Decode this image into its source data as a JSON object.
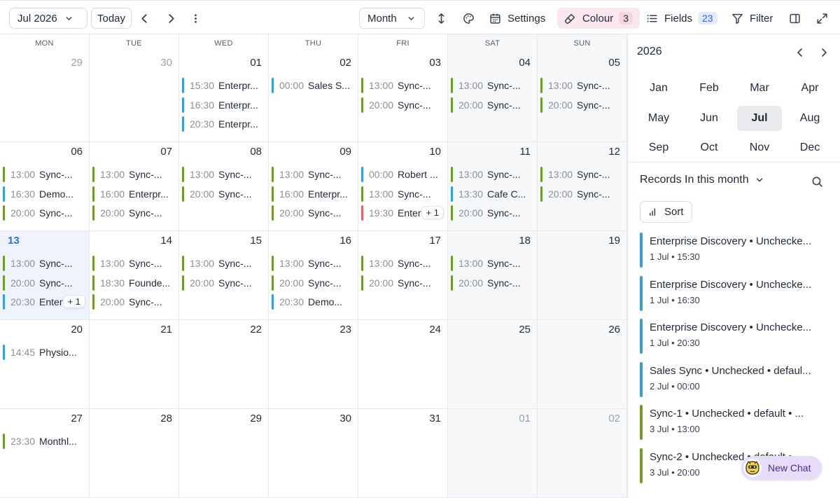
{
  "toolbar": {
    "date_label": "Jul 2026",
    "today_label": "Today",
    "view_label": "Month",
    "settings_label": "Settings",
    "colour_label": "Colour",
    "colour_count": "3",
    "fields_label": "Fields",
    "fields_count": "23",
    "filter_label": "Filter"
  },
  "colors": {
    "green": "#6f9b2c",
    "blue": "#3a9ed6",
    "red": "#e06565",
    "today_bg": "#eef3fe",
    "accent": "#2f6fe4"
  },
  "calendar": {
    "weekdays": [
      "MON",
      "TUE",
      "WED",
      "THU",
      "FRI",
      "SAT",
      "SUN"
    ],
    "days": [
      {
        "n": "29",
        "other": true,
        "events": []
      },
      {
        "n": "30",
        "other": true,
        "events": []
      },
      {
        "n": "01",
        "events": [
          {
            "t": "15:30",
            "l": "Enterpr...",
            "c": "blue"
          },
          {
            "t": "16:30",
            "l": "Enterpr...",
            "c": "blue"
          },
          {
            "t": "20:30",
            "l": "Enterpr...",
            "c": "blue"
          }
        ]
      },
      {
        "n": "02",
        "events": [
          {
            "t": "00:00",
            "l": "Sales S...",
            "c": "blue"
          }
        ]
      },
      {
        "n": "03",
        "events": [
          {
            "t": "13:00",
            "l": "Sync-...",
            "c": "green"
          },
          {
            "t": "20:00",
            "l": "Sync-...",
            "c": "green"
          }
        ]
      },
      {
        "n": "04",
        "weekend": true,
        "events": [
          {
            "t": "13:00",
            "l": "Sync-...",
            "c": "green"
          },
          {
            "t": "20:00",
            "l": "Sync-...",
            "c": "green"
          }
        ]
      },
      {
        "n": "05",
        "weekend": true,
        "events": [
          {
            "t": "13:00",
            "l": "Sync-...",
            "c": "green"
          },
          {
            "t": "20:00",
            "l": "Sync-...",
            "c": "green"
          }
        ]
      },
      {
        "n": "06",
        "events": [
          {
            "t": "13:00",
            "l": "Sync-...",
            "c": "green"
          },
          {
            "t": "16:30",
            "l": "Demo...",
            "c": "blue"
          },
          {
            "t": "20:00",
            "l": "Sync-...",
            "c": "green"
          }
        ]
      },
      {
        "n": "07",
        "events": [
          {
            "t": "13:00",
            "l": "Sync-...",
            "c": "green"
          },
          {
            "t": "16:00",
            "l": "Enterpr...",
            "c": "green"
          },
          {
            "t": "20:00",
            "l": "Sync-...",
            "c": "green"
          }
        ]
      },
      {
        "n": "08",
        "events": [
          {
            "t": "13:00",
            "l": "Sync-...",
            "c": "green"
          },
          {
            "t": "20:00",
            "l": "Sync-...",
            "c": "green"
          }
        ]
      },
      {
        "n": "09",
        "events": [
          {
            "t": "13:00",
            "l": "Sync-...",
            "c": "green"
          },
          {
            "t": "16:00",
            "l": "Enterpr...",
            "c": "green"
          },
          {
            "t": "20:00",
            "l": "Sync-...",
            "c": "green"
          }
        ]
      },
      {
        "n": "10",
        "more": "+ 1",
        "events": [
          {
            "t": "00:00",
            "l": "Robert ...",
            "c": "blue"
          },
          {
            "t": "13:00",
            "l": "Sync-...",
            "c": "green"
          },
          {
            "t": "19:30",
            "l": "Enter",
            "c": "red"
          }
        ]
      },
      {
        "n": "11",
        "weekend": true,
        "events": [
          {
            "t": "13:00",
            "l": "Sync-...",
            "c": "green"
          },
          {
            "t": "13:30",
            "l": "Cafe C...",
            "c": "blue"
          },
          {
            "t": "20:00",
            "l": "Sync-...",
            "c": "green"
          }
        ]
      },
      {
        "n": "12",
        "weekend": true,
        "events": [
          {
            "t": "13:00",
            "l": "Sync-...",
            "c": "green"
          },
          {
            "t": "20:00",
            "l": "Sync-...",
            "c": "green"
          }
        ]
      },
      {
        "n": "13",
        "today": true,
        "more": "+ 1",
        "events": [
          {
            "t": "13:00",
            "l": "Sync-...",
            "c": "green"
          },
          {
            "t": "20:00",
            "l": "Sync-...",
            "c": "green"
          },
          {
            "t": "20:30",
            "l": "Enter",
            "c": "blue"
          }
        ]
      },
      {
        "n": "14",
        "events": [
          {
            "t": "13:00",
            "l": "Sync-...",
            "c": "green"
          },
          {
            "t": "18:30",
            "l": "Founde...",
            "c": "green"
          },
          {
            "t": "20:00",
            "l": "Sync-...",
            "c": "green"
          }
        ]
      },
      {
        "n": "15",
        "events": [
          {
            "t": "13:00",
            "l": "Sync-...",
            "c": "green"
          },
          {
            "t": "20:00",
            "l": "Sync-...",
            "c": "green"
          }
        ]
      },
      {
        "n": "16",
        "events": [
          {
            "t": "13:00",
            "l": "Sync-...",
            "c": "green"
          },
          {
            "t": "20:00",
            "l": "Sync-...",
            "c": "green"
          },
          {
            "t": "20:30",
            "l": "Demo...",
            "c": "blue"
          }
        ]
      },
      {
        "n": "17",
        "events": [
          {
            "t": "13:00",
            "l": "Sync-...",
            "c": "green"
          },
          {
            "t": "20:00",
            "l": "Sync-...",
            "c": "green"
          }
        ]
      },
      {
        "n": "18",
        "weekend": true,
        "events": [
          {
            "t": "13:00",
            "l": "Sync-...",
            "c": "green"
          },
          {
            "t": "20:00",
            "l": "Sync-...",
            "c": "green"
          }
        ]
      },
      {
        "n": "19",
        "weekend": true,
        "events": []
      },
      {
        "n": "20",
        "events": [
          {
            "t": "14:45",
            "l": "Physio...",
            "c": "blue"
          }
        ]
      },
      {
        "n": "21",
        "events": []
      },
      {
        "n": "22",
        "events": []
      },
      {
        "n": "23",
        "events": []
      },
      {
        "n": "24",
        "events": []
      },
      {
        "n": "25",
        "weekend": true,
        "events": []
      },
      {
        "n": "26",
        "weekend": true,
        "events": []
      },
      {
        "n": "27",
        "events": [
          {
            "t": "23:30",
            "l": "Monthl...",
            "c": "green"
          }
        ]
      },
      {
        "n": "28",
        "events": []
      },
      {
        "n": "29",
        "events": []
      },
      {
        "n": "30",
        "events": []
      },
      {
        "n": "31",
        "events": []
      },
      {
        "n": "01",
        "weekend": true,
        "other": true,
        "events": []
      },
      {
        "n": "02",
        "weekend": true,
        "other": true,
        "events": []
      }
    ]
  },
  "side": {
    "year": "2026",
    "months": [
      "Jan",
      "Feb",
      "Mar",
      "Apr",
      "May",
      "Jun",
      "Jul",
      "Aug",
      "Sep",
      "Oct",
      "Nov",
      "Dec"
    ],
    "selected_month": "Jul",
    "records_label": "Records In this month",
    "sort_label": "Sort",
    "records": [
      {
        "title": "Enterprise Discovery • Unchecke...",
        "sub": "1 Jul • 15:30",
        "c": "blue"
      },
      {
        "title": "Enterprise Discovery • Unchecke...",
        "sub": "1 Jul • 16:30",
        "c": "blue"
      },
      {
        "title": "Enterprise Discovery • Unchecke...",
        "sub": "1 Jul • 20:30",
        "c": "blue"
      },
      {
        "title": "Sales Sync • Unchecked • defaul...",
        "sub": "2 Jul • 00:00",
        "c": "blue"
      },
      {
        "title": "Sync-1 • Unchecked • default • ...",
        "sub": "3 Jul • 13:00",
        "c": "green"
      },
      {
        "title": "Sync-2 • Unchecked • default • ...",
        "sub": "3 Jul • 20:00",
        "c": "green"
      }
    ]
  },
  "chat": {
    "label": "New Chat"
  }
}
